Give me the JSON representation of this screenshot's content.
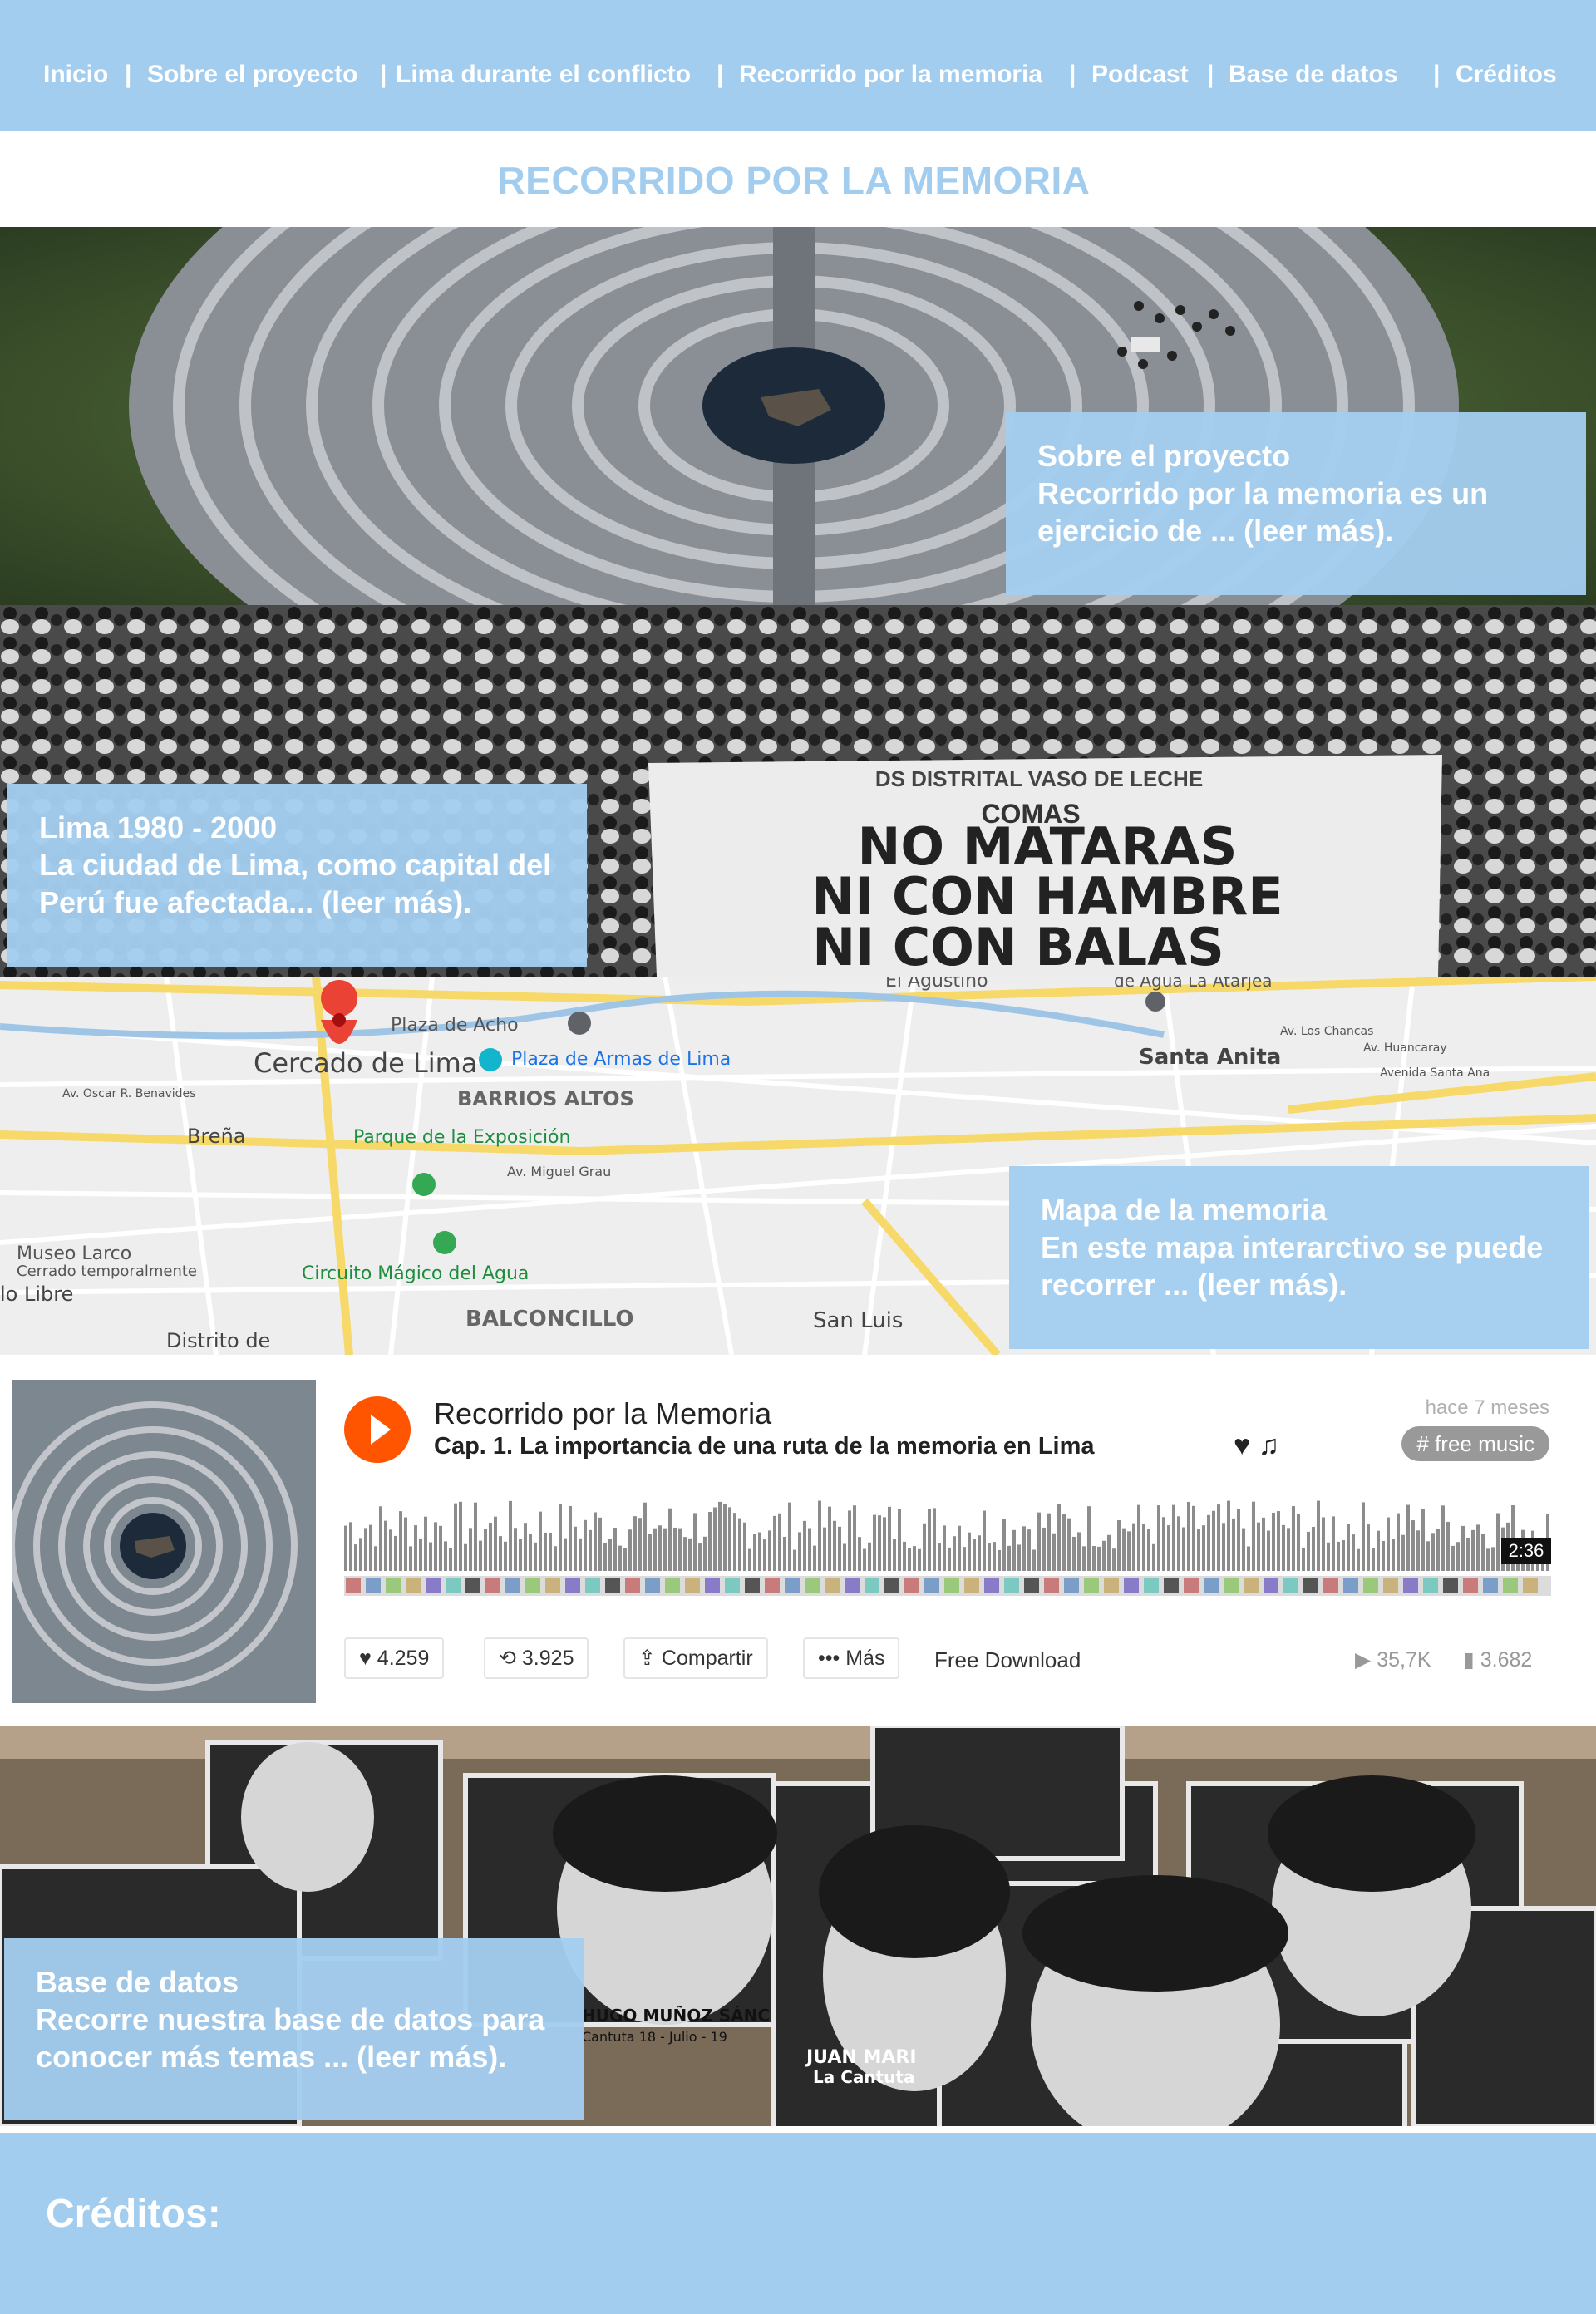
{
  "nav": {
    "items": [
      "Inicio",
      "Sobre el proyecto",
      "Lima durante el conflicto",
      "Recorrido por la memoria",
      "Podcast",
      "Base de datos",
      "Créditos"
    ],
    "separator": "|"
  },
  "page_title": "RECORRIDO POR LA MEMORIA",
  "sections": [
    {
      "heading": "Sobre el proyecto",
      "body": "Recorrido por la memoria es un ejercicio de ... (leer más)."
    },
    {
      "heading": "Lima 1980 - 2000",
      "body": "La ciudad de Lima, como capital del Perú fue afectada... (leer más)."
    },
    {
      "heading": "Mapa de la memoria",
      "body": "En este mapa interarctivo se puede recorrer ... (leer más)."
    },
    {
      "heading": "Base de datos",
      "body": "Recorre nuestra base de datos para conocer más temas ... (leer más)."
    }
  ],
  "banner": {
    "line1": "DS DISTRITAL VASO DE LECHE",
    "line2": "COMAS",
    "line3": "NO MATARAS",
    "line4": "NI CON HAMBRE",
    "line5": "NI CON BALAS"
  },
  "map": {
    "labels": [
      "El Agustino",
      "de Agua La Atarjea",
      "Plaza de Acho",
      "Plaza de Armas de Lima",
      "Cercado de Lima",
      "BARRIOS ALTOS",
      "Santa Anita",
      "Breña",
      "Parque de la Exposición",
      "Av. Miguel Grau",
      "Museo Larco",
      "Cerrado temporalmente",
      "Circuito Mágico del Agua",
      "BALCONCILLO",
      "San Luis",
      "Distrito de",
      "lo Libre",
      "Av. Oscar R. Benavides",
      "Av. Los Chancas",
      "Av. Huancaray",
      "Avenida Santa Ana"
    ]
  },
  "player": {
    "artist": "Recorrido por la Memoria",
    "track": "Cap. 1. La importancia de una ruta de la memoria en Lima",
    "date": "hace 7 meses",
    "tag": "# free music",
    "duration": "2:36",
    "likes": "4.259",
    "reposts": "3.925",
    "share": "Compartir",
    "more": "Más",
    "free_download": "Free Download",
    "plays": "35,7K",
    "comments": "3.682",
    "icons": "♥ ♫"
  },
  "portraits": {
    "caption1": "HUGO MUÑOZ SÁNC",
    "caption1b": "Cantuta 18 - Julio - 19",
    "caption2": "JUAN MARI",
    "caption2b": "La Cantuta"
  },
  "footer": {
    "title": "Créditos:"
  },
  "colors": {
    "accent": "#a3cdef",
    "soundcloud": "#ff5500"
  }
}
